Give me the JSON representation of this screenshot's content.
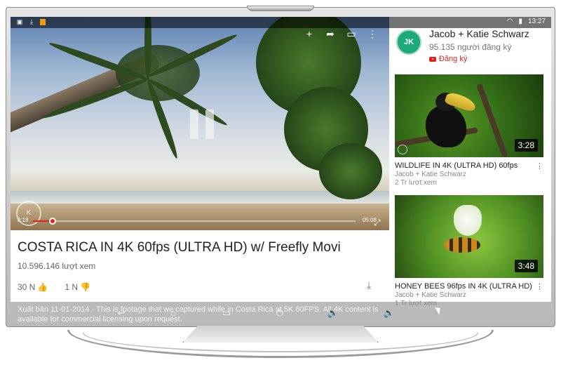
{
  "status_bar": {
    "time": "13:27",
    "left_icons": [
      "notification-icon",
      "download-icon",
      "app-icon"
    ],
    "right_icons": [
      "wifi-icon",
      "battery-icon"
    ]
  },
  "player": {
    "actions": [
      "add-icon",
      "share-icon",
      "cast-icon",
      "more-icon"
    ],
    "current_time": "0:18",
    "duration": "05:08",
    "progress_fraction": 0.06,
    "watermark_glyph": "K"
  },
  "video": {
    "title": "COSTA RICA IN 4K 60fps (ULTRA HD) w/ Freefly Movi",
    "views": "10.596.146 lượt xem",
    "likes": "30 N",
    "dislikes": "1 N",
    "description": "Xuất bản 11-01-2014 · This is footage that we captured while in Costa Rica at 5K 60FPS. All 4K content is available for commercial licensing upon request."
  },
  "channel": {
    "name": "Jacob + Katie Schwarz",
    "subscribers": "95.135 người đăng ký",
    "subscribe_label": "Đăng ký",
    "avatar_letters": "JK"
  },
  "related": [
    {
      "title": "WILDLIFE IN 4K (ULTRA HD) 60fps",
      "channel": "Jacob + Katie Schwarz",
      "views": "2 Tr lượt xem",
      "duration": "3:28"
    },
    {
      "title": "HONEY BEES 96fps IN 4K (ULTRA HD)",
      "channel": "Jacob + Katie Schwarz",
      "views": "1 Tr lượt xem",
      "duration": "3:48"
    }
  ],
  "nav_bar": [
    "back-icon",
    "home-icon",
    "recents-icon",
    "power-icon",
    "volume-down-icon",
    "volume-up-icon"
  ],
  "colors": {
    "accent": "#e62117",
    "avatar": "#1ea97c"
  }
}
